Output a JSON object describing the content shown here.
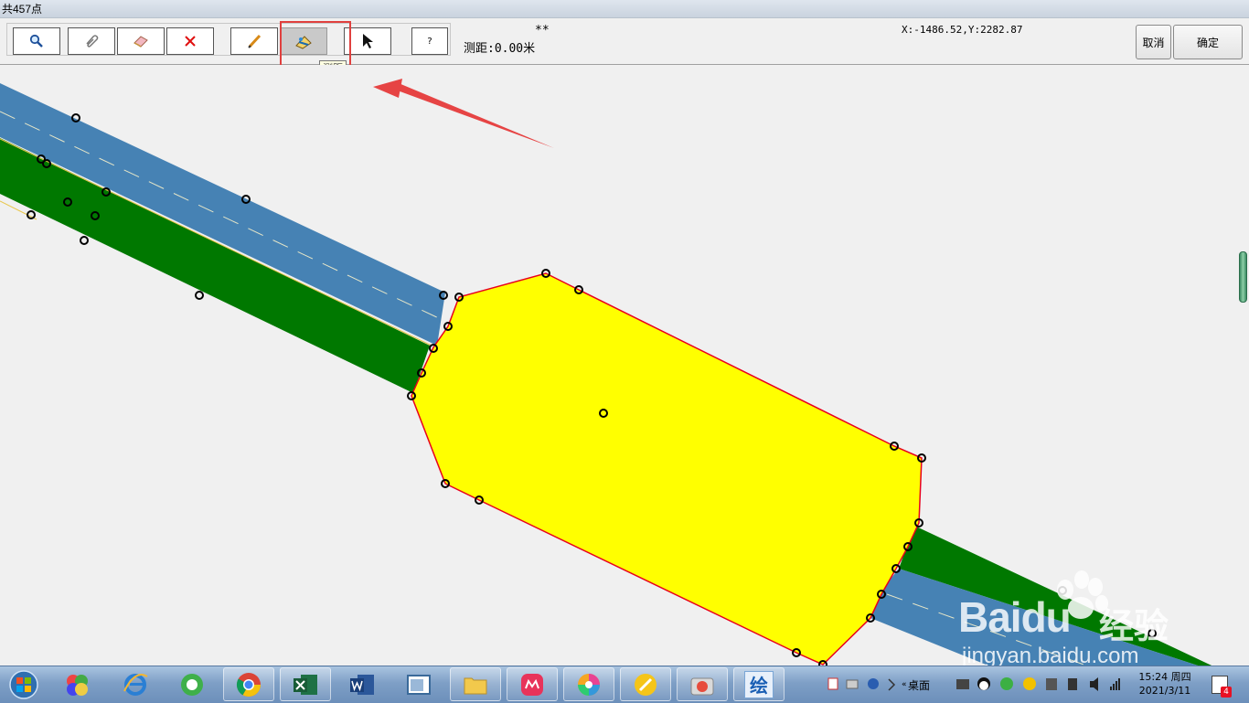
{
  "window": {
    "title": "共457点"
  },
  "toolbar": {
    "buttons": [
      {
        "name": "zoom",
        "icon": "magnifier-icon"
      },
      {
        "name": "pan",
        "icon": "paperclip-icon"
      },
      {
        "name": "erase",
        "icon": "eraser-icon"
      },
      {
        "name": "delete",
        "icon": "red-x-icon"
      },
      {
        "name": "draw",
        "icon": "pencil-icon"
      },
      {
        "name": "measure",
        "icon": "ruler-measure-icon",
        "active": true
      },
      {
        "name": "select",
        "icon": "arrow-cursor-icon"
      },
      {
        "name": "help",
        "label": "?"
      }
    ],
    "tooltip": "测距",
    "stars": "**",
    "distance_label": "测距:0.00米",
    "coordinates": "X:-1486.52,Y:2282.87",
    "cancel_label": "取消",
    "confirm_label": "确定"
  },
  "colors": {
    "road_blue": "#4682b4",
    "grass_green": "#007800",
    "area_yellow": "#ffff00",
    "outline_red": "#e8001c",
    "highlight_red": "#e0403e"
  },
  "taskbar": {
    "apps": [
      "start-orb",
      "color-app",
      "internet-explorer",
      "green-browser",
      "chrome",
      "excel",
      "word",
      "viewer-app",
      "file-explorer",
      "meitu-app",
      "photo-app",
      "edit-app",
      "camera-app",
      "drawing-app"
    ],
    "drawing_app_label": "绘",
    "desktop_label": "桌面",
    "time": "15:24 周四",
    "date": "2021/3/11",
    "notification_count": "4"
  },
  "watermark": {
    "brand": "Baidu",
    "brand_suffix": "经验",
    "url": "jingyan.baidu.com"
  }
}
